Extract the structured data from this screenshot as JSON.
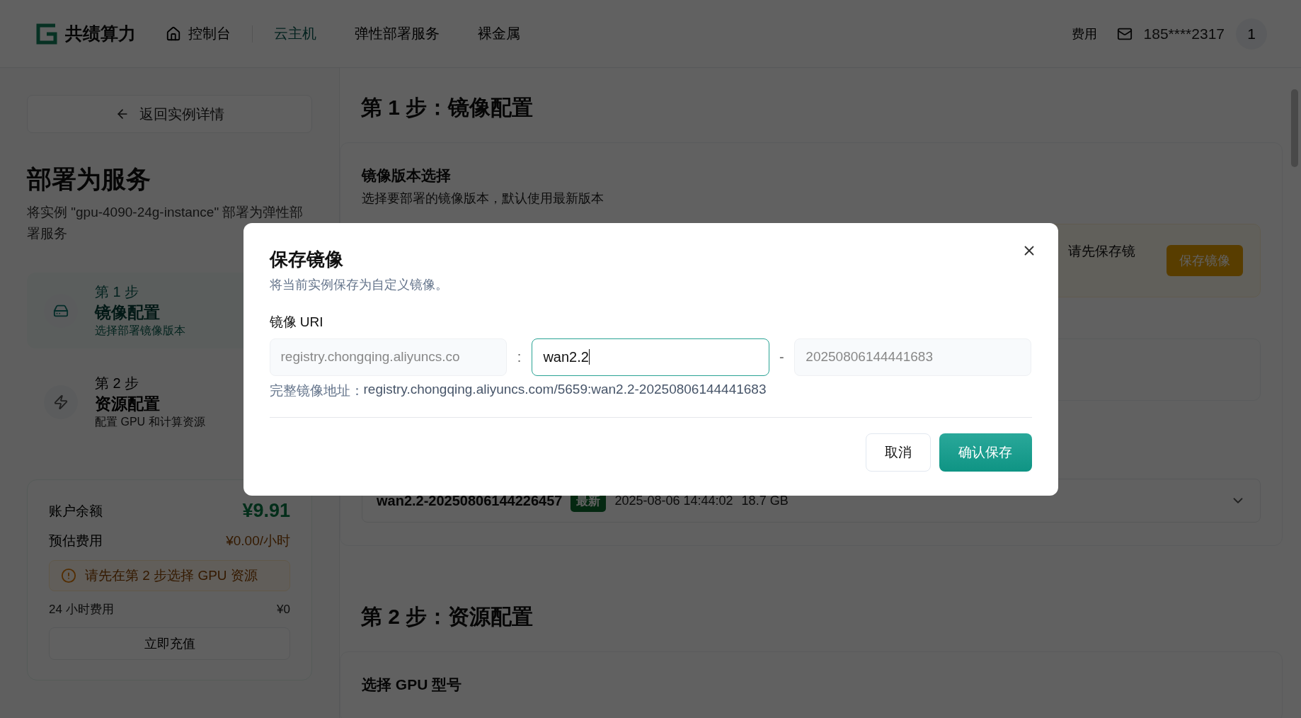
{
  "header": {
    "brand": "共绩算力",
    "nav": [
      {
        "label": "控制台",
        "selected": false
      },
      {
        "label": "云主机",
        "selected": true
      },
      {
        "label": "弹性部署服务",
        "selected": false
      },
      {
        "label": "裸金属",
        "selected": false
      }
    ],
    "fees": "费用",
    "phone": "185****2317",
    "avatar": "1"
  },
  "sidebar": {
    "back": "返回实例详情",
    "title": "部署为服务",
    "description": "将实例 \"gpu-4090-24g-instance\" 部署为弹性部署服务",
    "steps": [
      {
        "step": "第 1 步",
        "title": "镜像配置",
        "description": "选择部署镜像版本",
        "selected": true
      },
      {
        "step": "第 2 步",
        "title": "资源配置",
        "description": "配置 GPU 和计算资源",
        "selected": false
      }
    ],
    "balance": {
      "label": "账户余额",
      "amount": "¥9.91",
      "estimate_label": "预估费用",
      "estimate": "¥0.00/小时",
      "warning": "请先在第 2 步选择 GPU 资源",
      "daily_label": "24 小时费用",
      "daily": "¥0",
      "recharge": "立即充值"
    }
  },
  "main": {
    "step1_title": "第 1 步：镜像配置",
    "version_title": "镜像版本选择",
    "version_description": "选择要部署的镜像版本，默认使用最新版本",
    "notice": "请先保存镜",
    "save_image": "保存镜像",
    "selected_version": {
      "name": "wan2.2-20250806144226457",
      "badge": "最新",
      "date": "2025-08-06 14:44:02",
      "size": "18.7 GB"
    },
    "step2_title": "第 2 步：资源配置",
    "gpu_title": "选择 GPU 型号"
  },
  "modal": {
    "title": "保存镜像",
    "description": "将当前实例保存为自定义镜像。",
    "uri_label": "镜像 URI",
    "registry": "registry.chongqing.aliyuncs.co",
    "separator_1": ":",
    "tag": "wan2.2",
    "separator_2": "-",
    "version": "20250806144441683",
    "full_label": "完整镜像地址：",
    "full_value": "registry.chongqing.aliyuncs.com/5659:wan2.2-20250806144441683",
    "cancel": "取消",
    "confirm": "确认保存"
  }
}
